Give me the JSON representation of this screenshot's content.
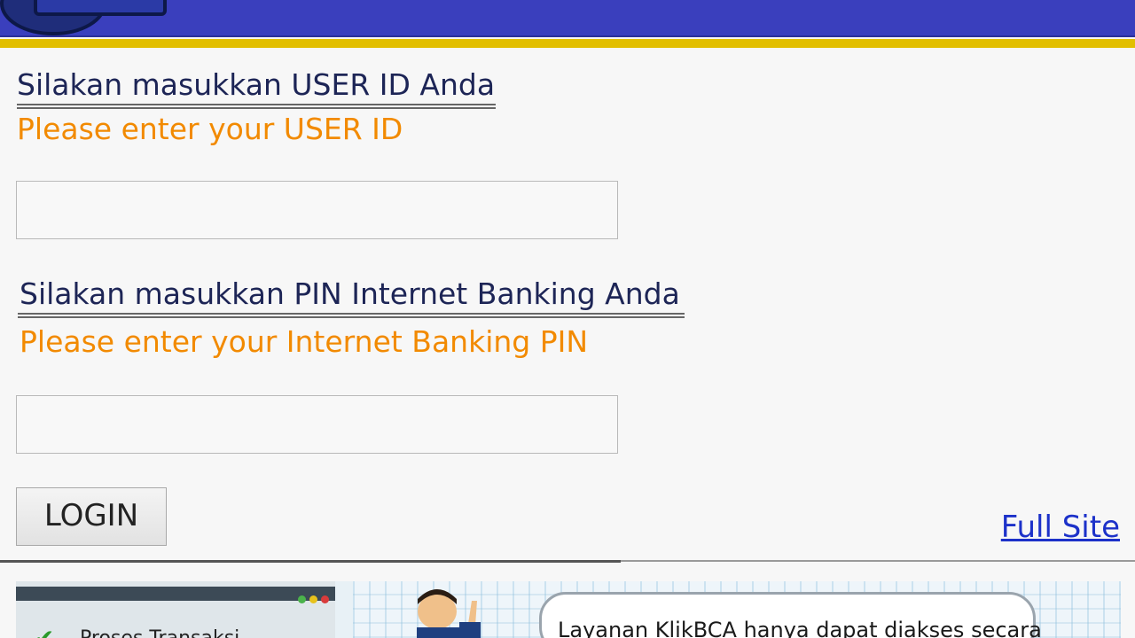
{
  "form": {
    "userid_heading": "Silakan masukkan USER ID Anda",
    "userid_sub": "Please enter your USER ID",
    "userid_value": "",
    "pin_heading": "Silakan masukkan PIN Internet Banking Anda",
    "pin_sub": "Please enter your Internet Banking PIN",
    "pin_value": "",
    "login_label": "LOGIN",
    "fullsite_label": "Full Site"
  },
  "banner": {
    "left_text": "Proses Transaksi",
    "bubble_text": "Layanan KlikBCA hanya dapat diakses secara"
  },
  "colors": {
    "header": "#3a3fbd",
    "accent_gold": "#e2bf00",
    "heading": "#1d2556",
    "subheading": "#f28a00",
    "link": "#1c31c9"
  },
  "icons": {
    "logo": "bank-logo-icon",
    "check": "check-icon",
    "person": "person-illustration"
  }
}
